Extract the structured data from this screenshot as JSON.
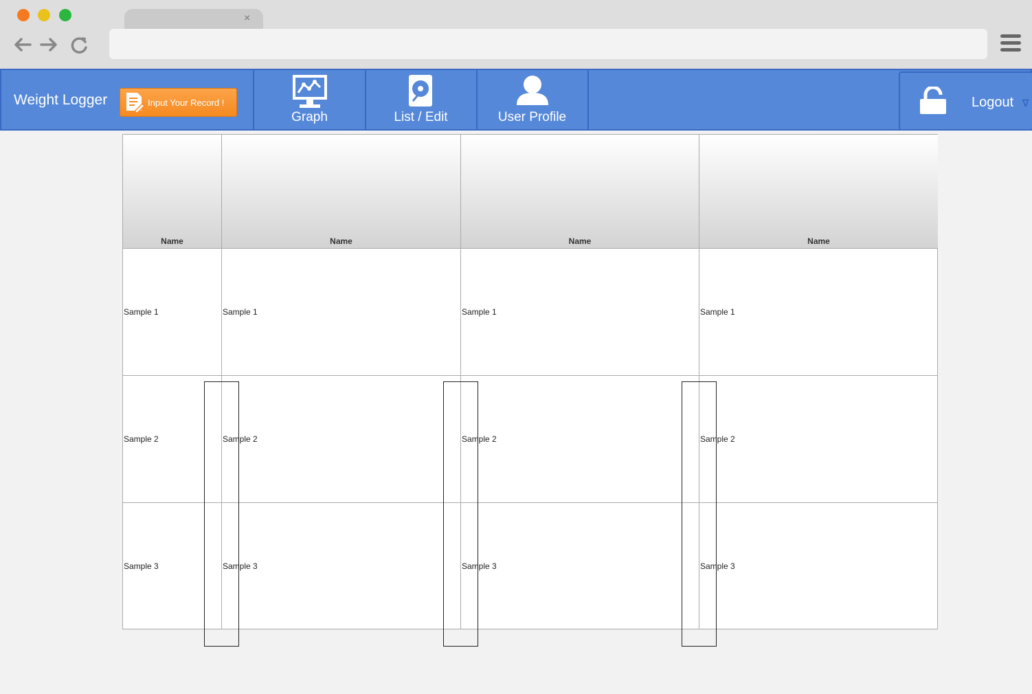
{
  "browser": {
    "tab_close": "×"
  },
  "header": {
    "app_title": "Weight Logger",
    "input_button": "Input Your Record !",
    "nav": [
      {
        "label": "Graph",
        "icon": "monitor-chart-icon"
      },
      {
        "label": "List / Edit",
        "icon": "disk-edit-icon"
      },
      {
        "label": "User Profile",
        "icon": "user-icon"
      }
    ],
    "logout": {
      "label": "Logout",
      "caret": "∇",
      "icon": "unlock-icon"
    },
    "colors": {
      "bar": "#5588d8",
      "border": "#3a68c4",
      "input_button": "#f58a20"
    }
  },
  "table": {
    "columns": [
      "Name",
      "Name",
      "Name",
      "Name"
    ],
    "rows": [
      [
        "Sample 1",
        "Sample 1",
        "Sample 1",
        "Sample 1"
      ],
      [
        "Sample 2",
        "Sample 2",
        "Sample 2",
        "Sample 2"
      ],
      [
        "Sample 3",
        "Sample 3",
        "Sample 3",
        "Sample 3"
      ]
    ]
  }
}
